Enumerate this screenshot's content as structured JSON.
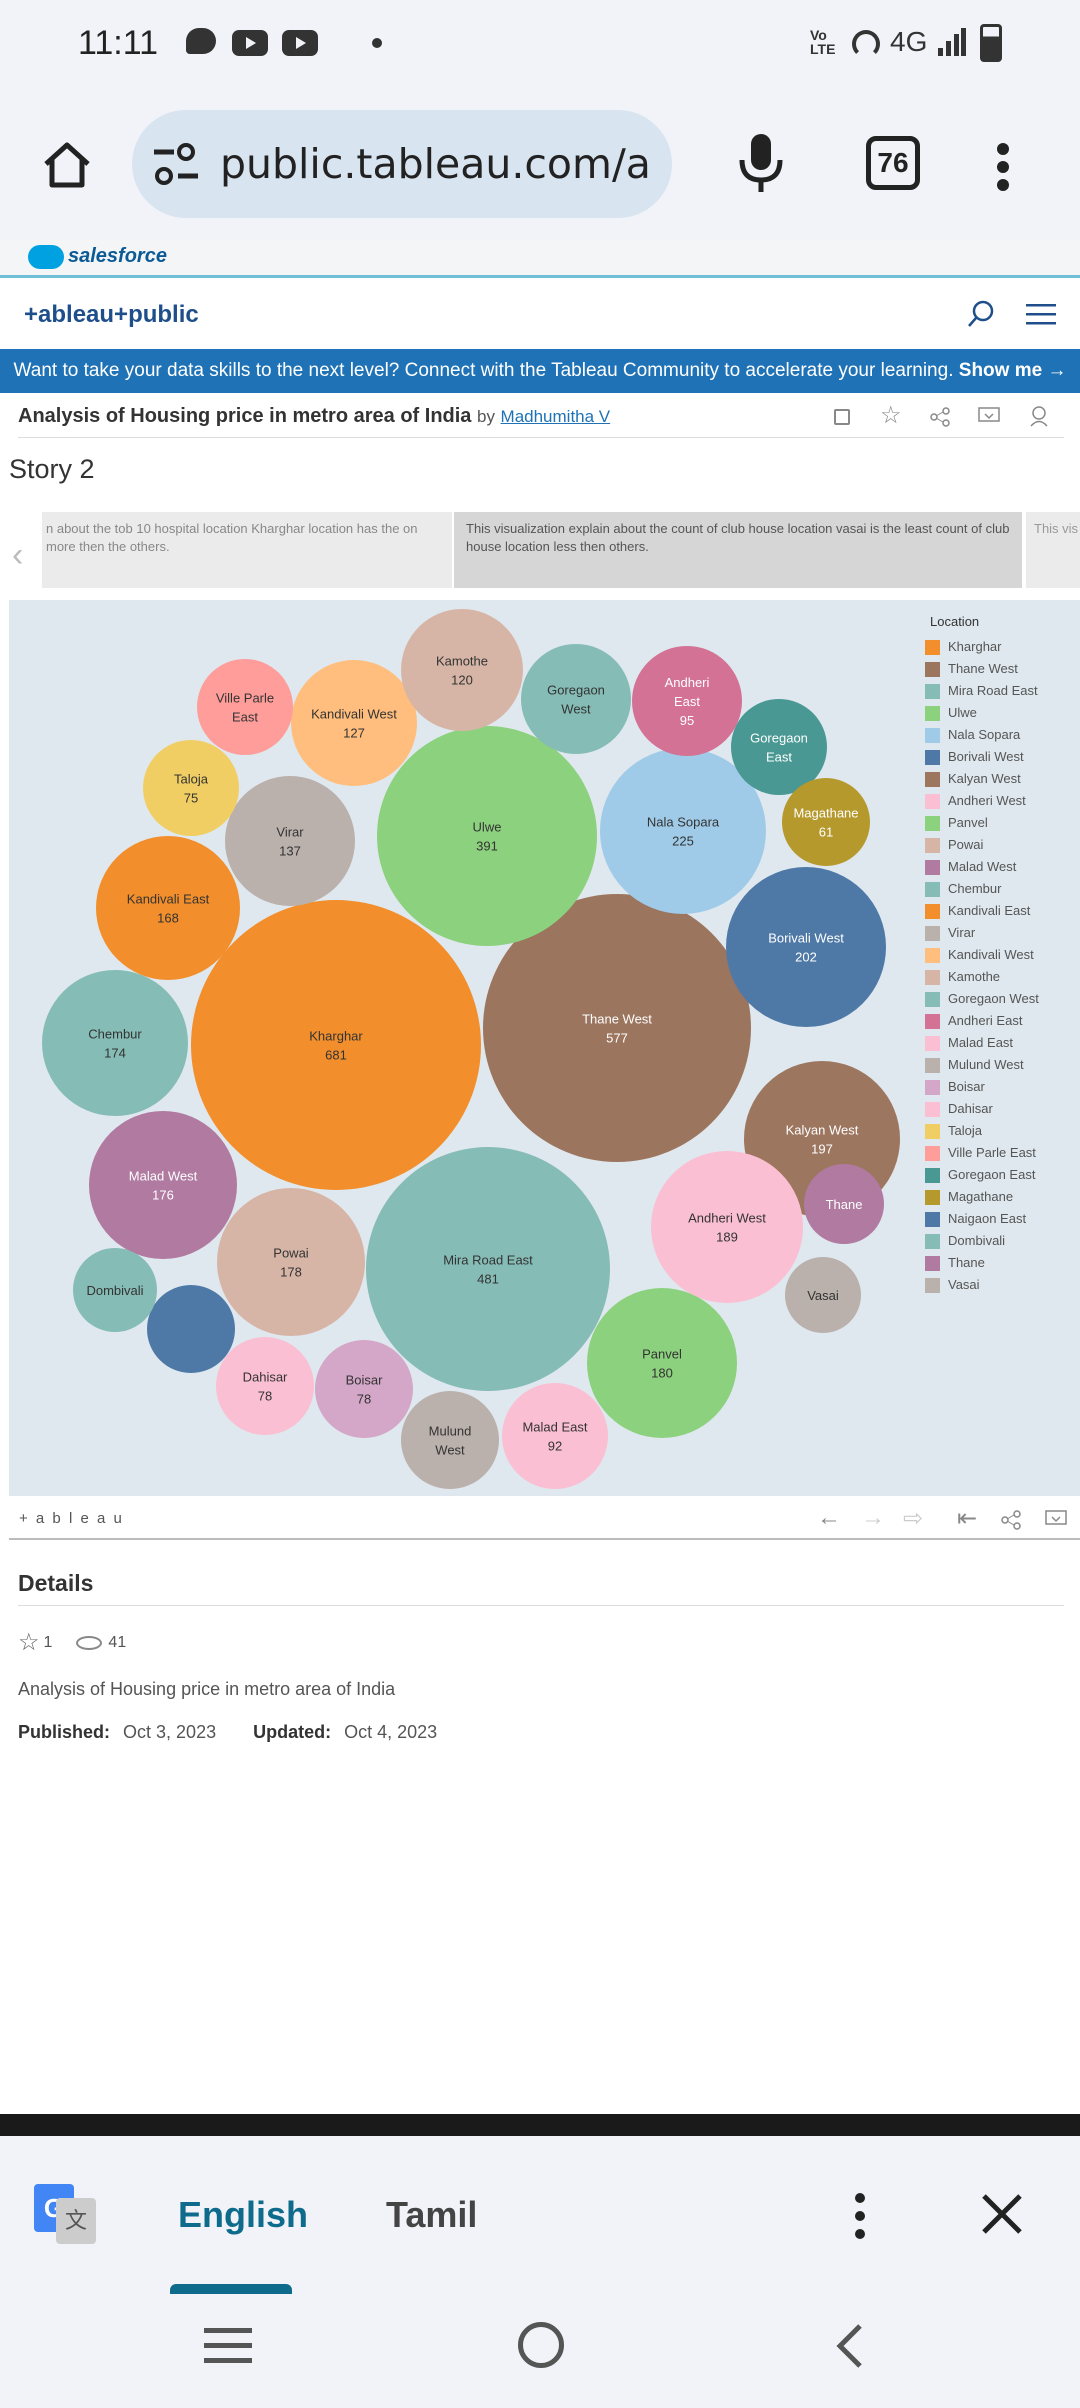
{
  "status": {
    "time": "11:11",
    "network": "4G",
    "volte": "Vo LTE"
  },
  "browser": {
    "url": "public.tableau.com/app/pı",
    "tabs_count": "76"
  },
  "salesforce": {
    "label": "salesforce"
  },
  "tableau": {
    "logo": "+ableau+public"
  },
  "banner": {
    "text": "Want to take your data skills to the next level? Connect with the Tableau Community to accelerate your learning.",
    "link": "Show me →"
  },
  "viz_title": {
    "title": "Analysis of Housing price in metro area of India",
    "by": "by",
    "author": "Madhumitha V"
  },
  "story": {
    "title": "Story 2",
    "points": [
      "n about the tob 10 hospital location Kharghar location has the on more then the others.",
      "This visualization explain about the count of club house location vasai is the least count of club house location less then others.",
      "This vis the mo"
    ]
  },
  "legend": {
    "title": "Location",
    "items": [
      {
        "label": "Kharghar",
        "color": "#f28e2b"
      },
      {
        "label": "Thane West",
        "color": "#9c755f"
      },
      {
        "label": "Mira Road East",
        "color": "#86bcb6"
      },
      {
        "label": "Ulwe",
        "color": "#8cd17d"
      },
      {
        "label": "Nala Sopara",
        "color": "#a0cbe8"
      },
      {
        "label": "Borivali West",
        "color": "#4e79a7"
      },
      {
        "label": "Kalyan West",
        "color": "#9d7660"
      },
      {
        "label": "Andheri West",
        "color": "#fabfd2"
      },
      {
        "label": "Panvel",
        "color": "#8cd17d"
      },
      {
        "label": "Powai",
        "color": "#d7b5a6"
      },
      {
        "label": "Malad West",
        "color": "#b07aa1"
      },
      {
        "label": "Chembur",
        "color": "#86bcb6"
      },
      {
        "label": "Kandivali East",
        "color": "#f28e2b"
      },
      {
        "label": "Virar",
        "color": "#bab0ac"
      },
      {
        "label": "Kandivali West",
        "color": "#ffbe7d"
      },
      {
        "label": "Kamothe",
        "color": "#d7b5a6"
      },
      {
        "label": "Goregaon West",
        "color": "#86bcb6"
      },
      {
        "label": "Andheri East",
        "color": "#d37295"
      },
      {
        "label": "Malad East",
        "color": "#fabfd2"
      },
      {
        "label": "Mulund West",
        "color": "#bab0ac"
      },
      {
        "label": "Boisar",
        "color": "#d4a6c8"
      },
      {
        "label": "Dahisar",
        "color": "#fabfd2"
      },
      {
        "label": "Taloja",
        "color": "#f1ce63"
      },
      {
        "label": "Ville Parle East",
        "color": "#ff9d9a"
      },
      {
        "label": "Goregaon East",
        "color": "#499894"
      },
      {
        "label": "Magathane",
        "color": "#b6992d"
      },
      {
        "label": "Naigaon East",
        "color": "#4e79a7"
      },
      {
        "label": "Dombivali",
        "color": "#86bcb6"
      },
      {
        "label": "Thane",
        "color": "#b07aa1"
      },
      {
        "label": "Vasai",
        "color": "#bab0ac"
      }
    ]
  },
  "chart_data": {
    "type": "bubble",
    "title": "",
    "series": [
      {
        "name": "Kharghar",
        "value": 681,
        "color": "#f28e2b",
        "text": "#333"
      },
      {
        "name": "Thane West",
        "value": 577,
        "color": "#9c755f",
        "text": "#fff"
      },
      {
        "name": "Mira Road East",
        "value": 481,
        "color": "#86bcb6",
        "text": "#333"
      },
      {
        "name": "Ulwe",
        "value": 391,
        "color": "#8cd17d",
        "text": "#333"
      },
      {
        "name": "Nala Sopara",
        "value": 225,
        "color": "#a0cbe8",
        "text": "#333"
      },
      {
        "name": "Borivali West",
        "value": 202,
        "color": "#4e79a7",
        "text": "#fff"
      },
      {
        "name": "Kalyan West",
        "value": 197,
        "color": "#9d7660",
        "text": "#fff"
      },
      {
        "name": "Andheri West",
        "value": 189,
        "color": "#fabfd2",
        "text": "#333"
      },
      {
        "name": "Panvel",
        "value": 180,
        "color": "#8cd17d",
        "text": "#333"
      },
      {
        "name": "Powai",
        "value": 178,
        "color": "#d7b5a6",
        "text": "#333"
      },
      {
        "name": "Malad West",
        "value": 176,
        "color": "#b07aa1",
        "text": "#fff"
      },
      {
        "name": "Chembur",
        "value": 174,
        "color": "#86bcb6",
        "text": "#333"
      },
      {
        "name": "Kandivali East",
        "value": 168,
        "color": "#f28e2b",
        "text": "#333"
      },
      {
        "name": "Virar",
        "value": 137,
        "color": "#bab0ac",
        "text": "#333"
      },
      {
        "name": "Kandivali West",
        "value": 127,
        "color": "#ffbe7d",
        "text": "#333"
      },
      {
        "name": "Kamothe",
        "value": 120,
        "color": "#d7b5a6",
        "text": "#333"
      },
      {
        "name": "Goregaon West",
        "value": null,
        "color": "#86bcb6",
        "text": "#333"
      },
      {
        "name": "Andheri East",
        "value": 95,
        "color": "#d37295",
        "text": "#fff"
      },
      {
        "name": "Malad East",
        "value": 92,
        "color": "#fabfd2",
        "text": "#333"
      },
      {
        "name": "Mulund West",
        "value": null,
        "color": "#bab0ac",
        "text": "#333"
      },
      {
        "name": "Boisar",
        "value": 78,
        "color": "#d4a6c8",
        "text": "#333"
      },
      {
        "name": "Dahisar",
        "value": 78,
        "color": "#fabfd2",
        "text": "#333"
      },
      {
        "name": "Taloja",
        "value": 75,
        "color": "#f1ce63",
        "text": "#333"
      },
      {
        "name": "Ville Parle East",
        "value": null,
        "color": "#ff9d9a",
        "text": "#333"
      },
      {
        "name": "Goregaon East",
        "value": null,
        "color": "#499894",
        "text": "#fff"
      },
      {
        "name": "Magathane",
        "value": 61,
        "color": "#b6992d",
        "text": "#fff"
      },
      {
        "name": "Naigaon East",
        "value": null,
        "color": "#4e79a7",
        "text": "#fff"
      },
      {
        "name": "Dombivali",
        "value": null,
        "color": "#86bcb6",
        "text": "#333"
      },
      {
        "name": "Thane",
        "value": null,
        "color": "#b07aa1",
        "text": "#fff"
      },
      {
        "name": "Vasai",
        "value": null,
        "color": "#bab0ac",
        "text": "#333"
      }
    ]
  },
  "viz_toolbar": {
    "logo": "+ a b l e a u"
  },
  "details": {
    "heading": "Details",
    "favorites": "1",
    "views": "41",
    "description": "Analysis of Housing price in metro area of India",
    "published_label": "Published:",
    "published": "Oct 3, 2023",
    "updated_label": "Updated:",
    "updated": "Oct 4, 2023"
  },
  "translate": {
    "lang1": "English",
    "lang2": "Tamil"
  }
}
